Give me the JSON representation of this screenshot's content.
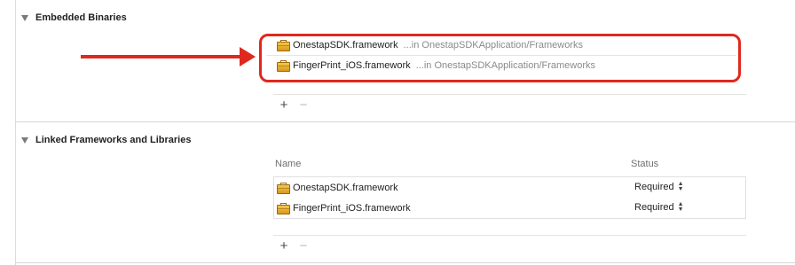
{
  "embedded": {
    "title": "Embedded Binaries",
    "items": [
      {
        "name": "OnestapSDK.framework",
        "path": "...in OnestapSDKApplication/Frameworks"
      },
      {
        "name": "FingerPrint_iOS.framework",
        "path": "...in OnestapSDKApplication/Frameworks"
      }
    ],
    "add_label": "+",
    "remove_label": "−"
  },
  "linked": {
    "title": "Linked Frameworks and Libraries",
    "columns": {
      "name": "Name",
      "status": "Status"
    },
    "items": [
      {
        "name": "OnestapSDK.framework",
        "status": "Required"
      },
      {
        "name": "FingerPrint_iOS.framework",
        "status": "Required"
      }
    ],
    "add_label": "+",
    "remove_label": "−"
  },
  "annotation": {
    "highlight_color": "#e0281e"
  },
  "icons": {
    "framework": "framework-briefcase-icon",
    "disclosure": "disclosure-triangle-icon",
    "stepper": "up-down-stepper-icon"
  }
}
